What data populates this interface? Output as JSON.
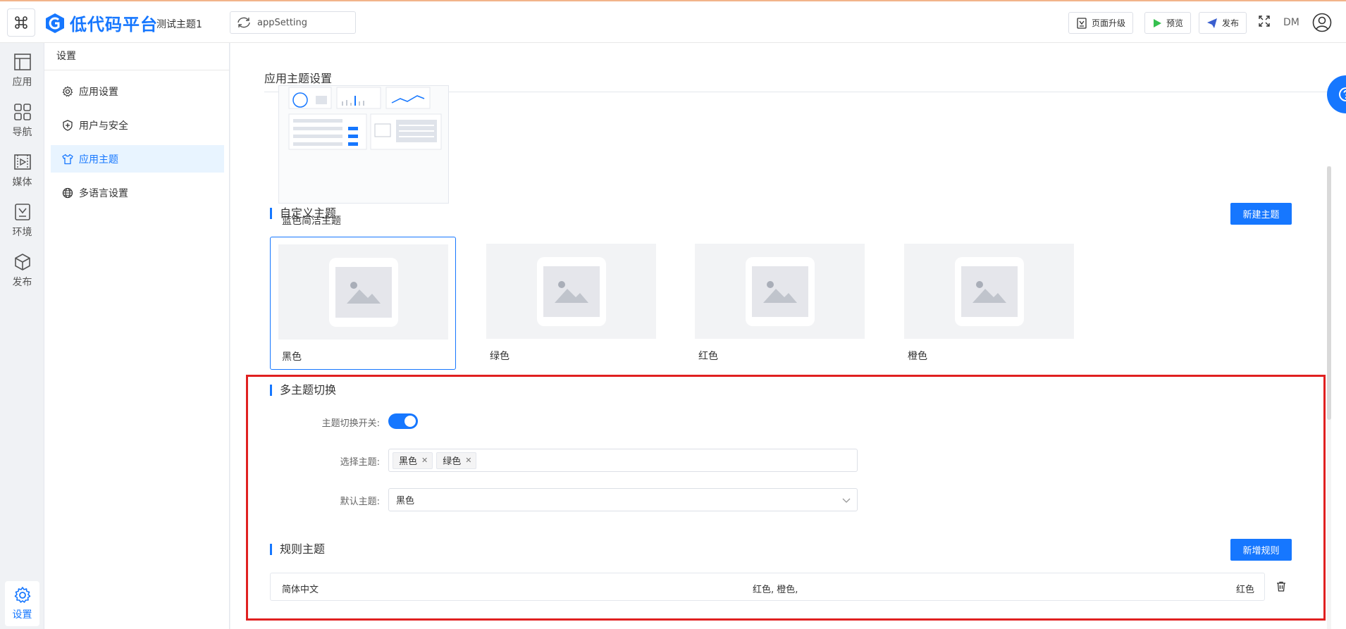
{
  "header": {
    "logo_text": "低代码平台",
    "project_name": "测试主题1",
    "app_select": "appSetting",
    "buttons": {
      "upgrade": "页面升级",
      "preview": "预览",
      "publish": "发布"
    },
    "user_initials": "DM"
  },
  "rail": {
    "items": [
      {
        "label": "应用",
        "icon": "app-layout-icon"
      },
      {
        "label": "导航",
        "icon": "nav-grid-icon"
      },
      {
        "label": "媒体",
        "icon": "media-icon"
      },
      {
        "label": "环境",
        "icon": "env-icon"
      },
      {
        "label": "发布",
        "icon": "cube-icon"
      }
    ],
    "settings_label": "设置"
  },
  "sidebar": {
    "title": "设置",
    "items": [
      {
        "label": "应用设置",
        "icon": "gear-icon"
      },
      {
        "label": "用户与安全",
        "icon": "shield-icon"
      },
      {
        "label": "应用主题",
        "icon": "shirt-icon",
        "active": true
      },
      {
        "label": "多语言设置",
        "icon": "globe-icon"
      }
    ]
  },
  "main": {
    "title": "应用主题设置",
    "preset_theme_label": "蓝色简洁主题",
    "custom_section": {
      "title": "自定义主题",
      "new_button": "新建主题",
      "themes": [
        "黑色",
        "绿色",
        "红色",
        "橙色"
      ],
      "selected_index": 0
    },
    "multi_section": {
      "title": "多主题切换",
      "switch_label": "主题切换开关:",
      "switch_on": true,
      "select_label": "选择主题:",
      "selected_tags": [
        "黑色",
        "绿色"
      ],
      "default_label": "默认主题:",
      "default_value": "黑色"
    },
    "rules_section": {
      "title": "规则主题",
      "add_button": "新增规则",
      "rows": [
        {
          "language": "简体中文",
          "themes": "红色, 橙色,",
          "default": "红色"
        }
      ]
    }
  },
  "colors": {
    "accent": "#1677ff",
    "highlight_box": "#e02020"
  }
}
